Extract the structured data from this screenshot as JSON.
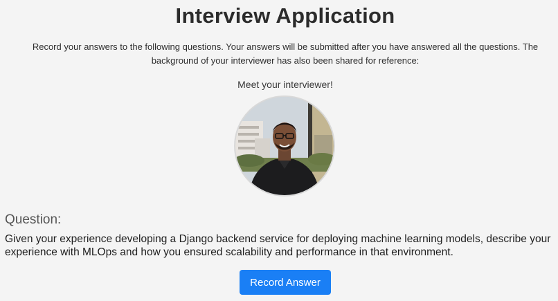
{
  "header": {
    "title": "Interview Application"
  },
  "intro": {
    "text": "Record your answers to the following questions. Your answers will be submitted after you have answered all the questions. The background of your interviewer has also been shared for reference:"
  },
  "interviewer": {
    "caption": "Meet your interviewer!",
    "photo_icon": "interviewer-photo"
  },
  "question": {
    "label": "Question:",
    "text": "Given your experience developing a Django backend service for deploying machine learning models, describe your experience with MLOps and how you ensured scalability and performance in that environment."
  },
  "actions": {
    "record_label": "Record Answer"
  },
  "colors": {
    "background": "#f4f4f4",
    "button": "#1a7ff5",
    "button_text": "#ffffff",
    "title": "#2b2b2b"
  }
}
